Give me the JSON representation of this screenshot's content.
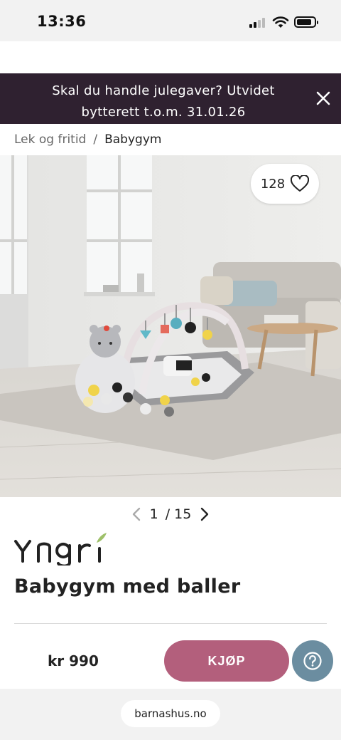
{
  "status_bar": {
    "time": "13:36"
  },
  "promo": {
    "text": "Skal du handle julegaver? Utvidet bytterett t.o.m. 31.01.26"
  },
  "breadcrumb": {
    "parent": "Lek og fritid",
    "separator": "/",
    "current": "Babygym"
  },
  "gallery": {
    "likes": "128",
    "current": "1",
    "total": "/ 15"
  },
  "product": {
    "brand": "Yngri",
    "title": "Babygym med baller",
    "price": "kr 990",
    "buy_label": "KJØP"
  },
  "browser": {
    "url": "barnashus.no"
  },
  "colors": {
    "promo_bg": "#2f2130",
    "buy_button": "#b35f7c",
    "help_button": "#6b8da0"
  }
}
